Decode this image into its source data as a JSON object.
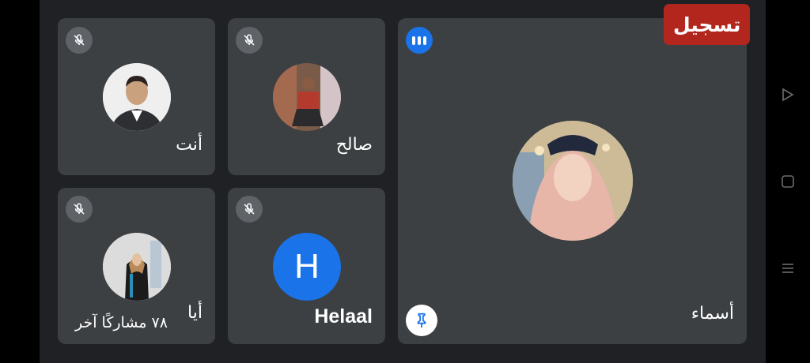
{
  "recording_label": "تسجيل",
  "participants": [
    {
      "name": "أنت"
    },
    {
      "name": "صالح"
    },
    {
      "name": "أسماء"
    },
    {
      "name": "Helaal",
      "initial": "H"
    },
    {
      "name": "أيا"
    }
  ],
  "others_count_label": "٧٨ مشاركًا آخر",
  "colors": {
    "recording_bg": "#b3261e",
    "tile_bg": "#3c4043",
    "helaal_avatar": "#1a73e8",
    "speaking_indicator": "#1a73e8"
  },
  "icons": [
    "mic-off-icon",
    "speaking-indicator-icon",
    "pin-icon",
    "nav-back-icon",
    "nav-home-icon",
    "nav-recents-icon"
  ]
}
